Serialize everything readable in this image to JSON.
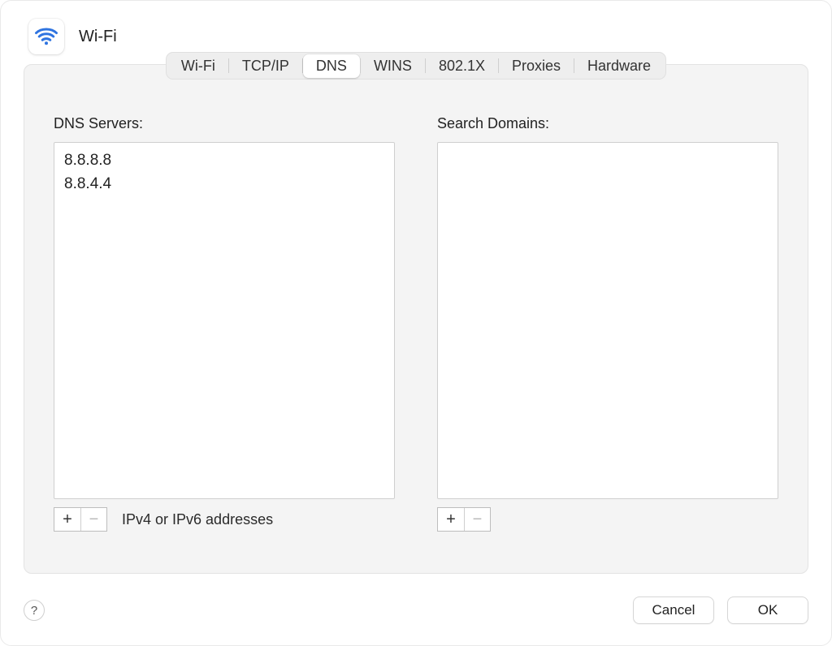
{
  "header": {
    "title": "Wi-Fi"
  },
  "tabs": {
    "items": [
      "Wi-Fi",
      "TCP/IP",
      "DNS",
      "WINS",
      "802.1X",
      "Proxies",
      "Hardware"
    ],
    "active_index": 2
  },
  "dns": {
    "label": "DNS Servers:",
    "items": [
      "8.8.8.8",
      "8.8.4.4"
    ],
    "hint": "IPv4 or IPv6 addresses"
  },
  "search_domains": {
    "label": "Search Domains:",
    "items": []
  },
  "buttons": {
    "help_glyph": "?",
    "plus_glyph": "+",
    "minus_glyph": "−",
    "cancel": "Cancel",
    "ok": "OK"
  }
}
